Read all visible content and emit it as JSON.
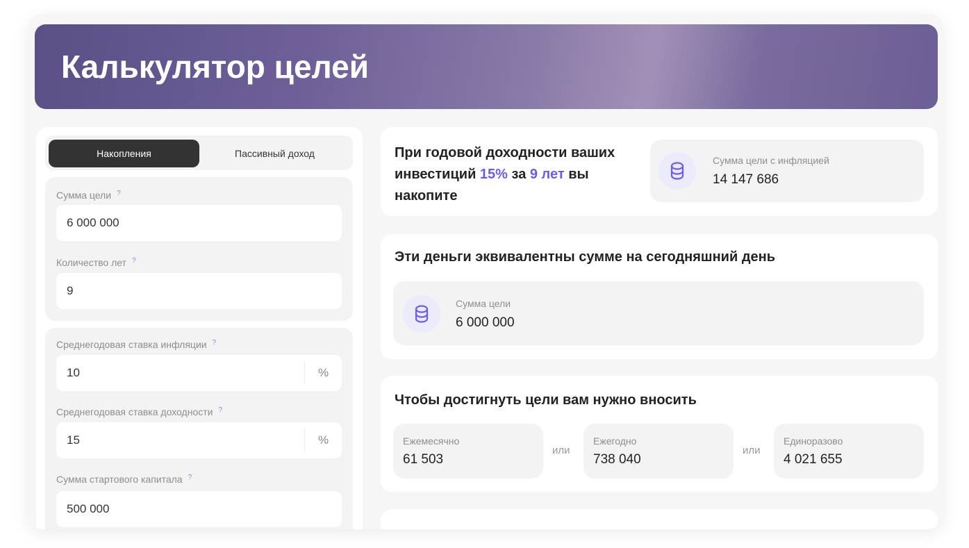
{
  "header": {
    "title": "Калькулятор целей"
  },
  "tabs": {
    "savings": "Накопления",
    "passive": "Пассивный доход"
  },
  "form": {
    "goal_sum": {
      "label": "Сумма цели",
      "value": "6 000 000"
    },
    "years": {
      "label": "Количество лет",
      "value": "9"
    },
    "inflation": {
      "label": "Среднегодовая ставка инфляции",
      "value": "10",
      "unit": "%"
    },
    "yield": {
      "label": "Среднегодовая ставка доходности",
      "value": "15",
      "unit": "%"
    },
    "start_capital": {
      "label": "Сумма стартового капитала",
      "value": "500 000"
    },
    "help": "?"
  },
  "result1": {
    "text_a": "При годовой доходности ваших инвестиций ",
    "rate": "15%",
    "text_b": " за ",
    "years": "9 лет",
    "text_c": " вы накопите",
    "stat_label": "Сумма цели с инфляцией",
    "stat_value": "14 147 686"
  },
  "result2": {
    "title": "Эти деньги эквивалентны сумме на сегодняшний день",
    "stat_label": "Сумма цели",
    "stat_value": "6 000 000"
  },
  "result3": {
    "title": "Чтобы достигнуть цели вам нужно вносить",
    "or": "или",
    "monthly": {
      "label": "Ежемесячно",
      "value": "61 503"
    },
    "yearly": {
      "label": "Ежегодно",
      "value": "738 040"
    },
    "once": {
      "label": "Единоразово",
      "value": "4 021 655"
    }
  },
  "colors": {
    "accent": "#6b5cf0",
    "dark": "#333333"
  }
}
